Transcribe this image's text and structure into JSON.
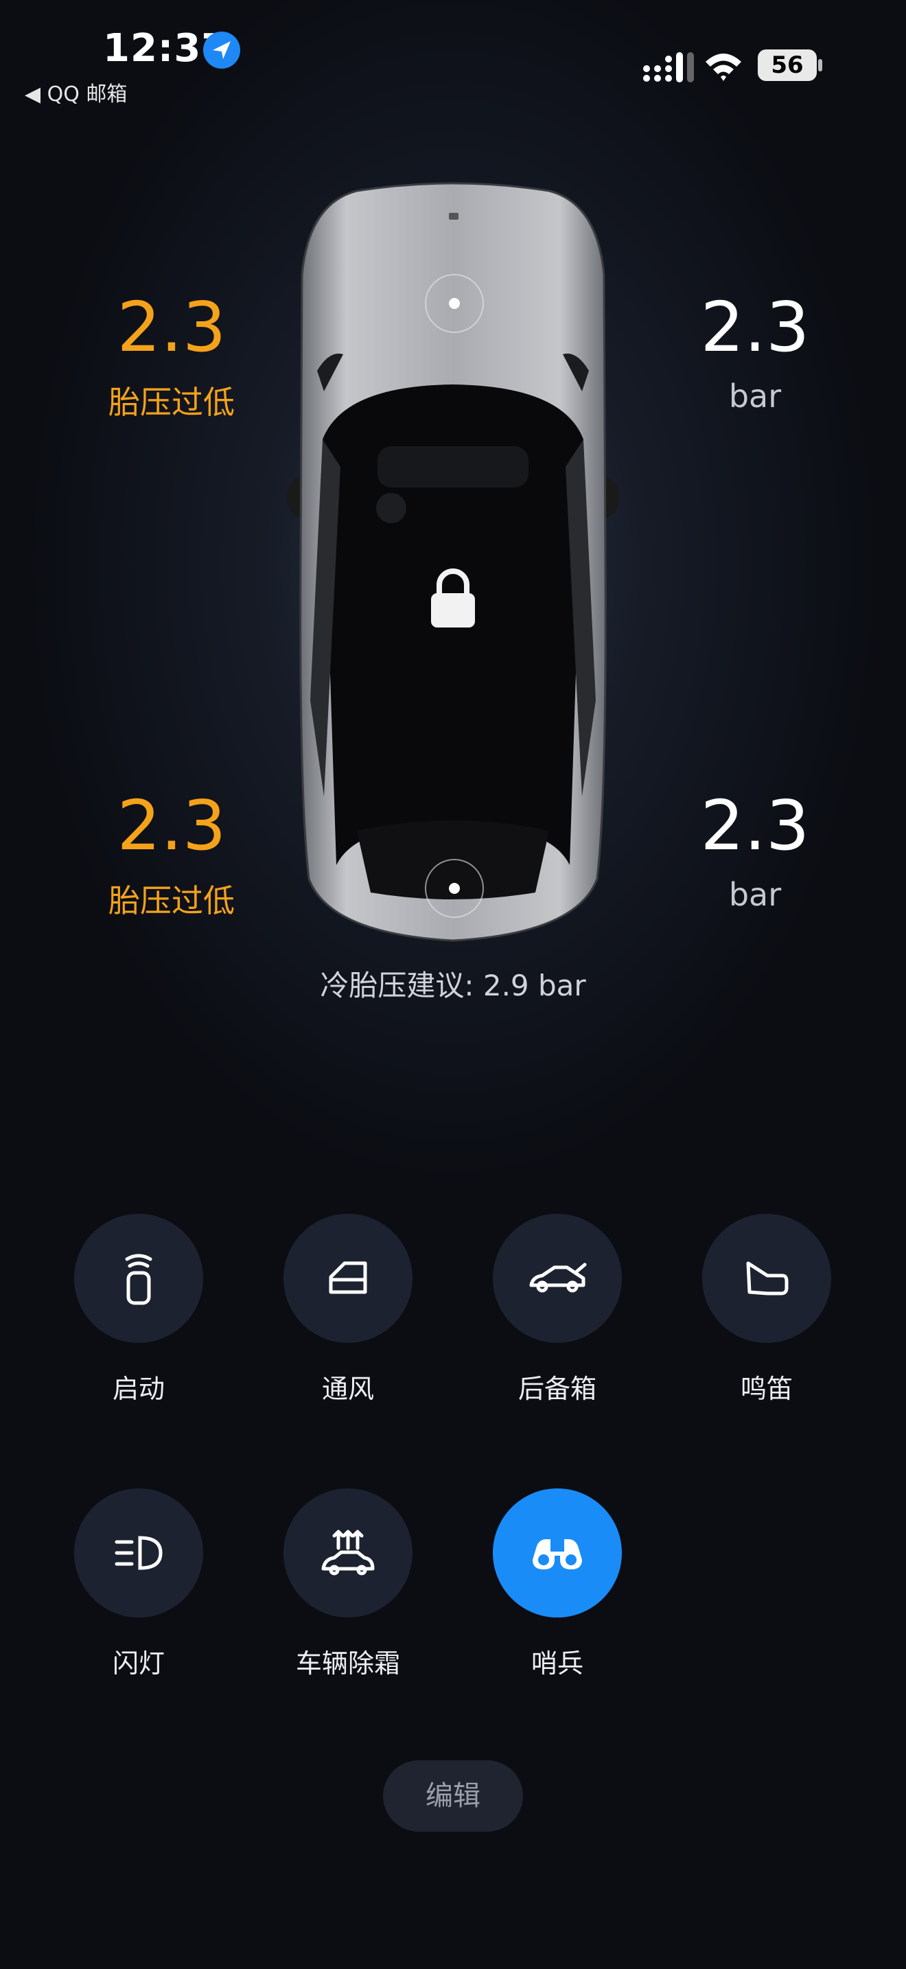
{
  "status_bar": {
    "time": "12:37",
    "back_app": "◀ QQ 邮箱",
    "battery": "56"
  },
  "tires": {
    "front_left": {
      "value": "2.3",
      "sub": "胎压过低",
      "status_color": "#f5a21b"
    },
    "front_right": {
      "value": "2.3",
      "sub": "bar"
    },
    "rear_left": {
      "value": "2.3",
      "sub": "胎压过低",
      "status_color": "#f5a21b"
    },
    "rear_right": {
      "value": "2.3",
      "sub": "bar"
    }
  },
  "advice": "冷胎压建议: 2.9 bar",
  "controls": [
    {
      "label": "启动",
      "icon": "remote-key-icon"
    },
    {
      "label": "通风",
      "icon": "window-icon"
    },
    {
      "label": "后备箱",
      "icon": "trunk-icon"
    },
    {
      "label": "鸣笛",
      "icon": "horn-icon"
    },
    {
      "label": "闪灯",
      "icon": "headlight-icon"
    },
    {
      "label": "车辆除霜",
      "icon": "defrost-icon"
    },
    {
      "label": "哨兵",
      "icon": "binoculars-icon",
      "active": true
    }
  ],
  "edit_label": "编辑",
  "colors": {
    "accent": "#1a8cf7",
    "warning": "#f5a21b",
    "button_bg": "#1d2230"
  }
}
